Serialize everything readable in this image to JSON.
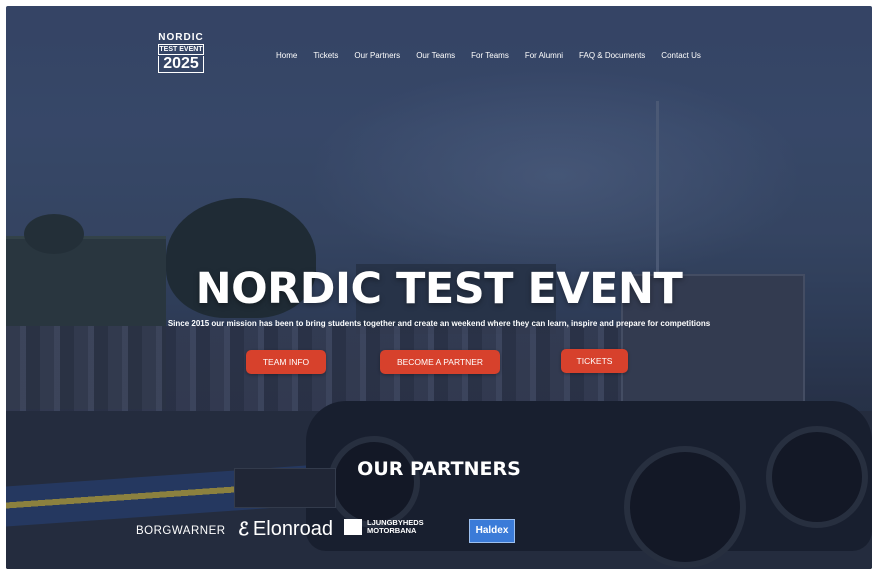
{
  "logo": {
    "line1": "NORDIC",
    "line2": "TEST EVENT",
    "line3": "2025"
  },
  "nav": {
    "items": [
      "Home",
      "Tickets",
      "Our Partners",
      "Our Teams",
      "For Teams",
      "For Alumni",
      "FAQ & Documents",
      "Contact Us"
    ]
  },
  "hero": {
    "title": "NORDIC TEST EVENT",
    "subtitle": "Since 2015 our mission has been to bring students together and create an weekend where they can learn, inspire and prepare for competitions",
    "buttons": {
      "team_info": "TEAM INFO",
      "become_partner": "BECOME A PARTNER",
      "tickets": "TICKETS"
    }
  },
  "partners": {
    "heading": "OUR PARTNERS",
    "logos": [
      "BORGWARNER",
      "Elonroad",
      "LJUNGBYHEDS MOTORBANA",
      "Haldex"
    ]
  },
  "colors": {
    "accent": "#d7412c",
    "overlay": "#2e3f60",
    "haldex": "#3b7bd8"
  }
}
